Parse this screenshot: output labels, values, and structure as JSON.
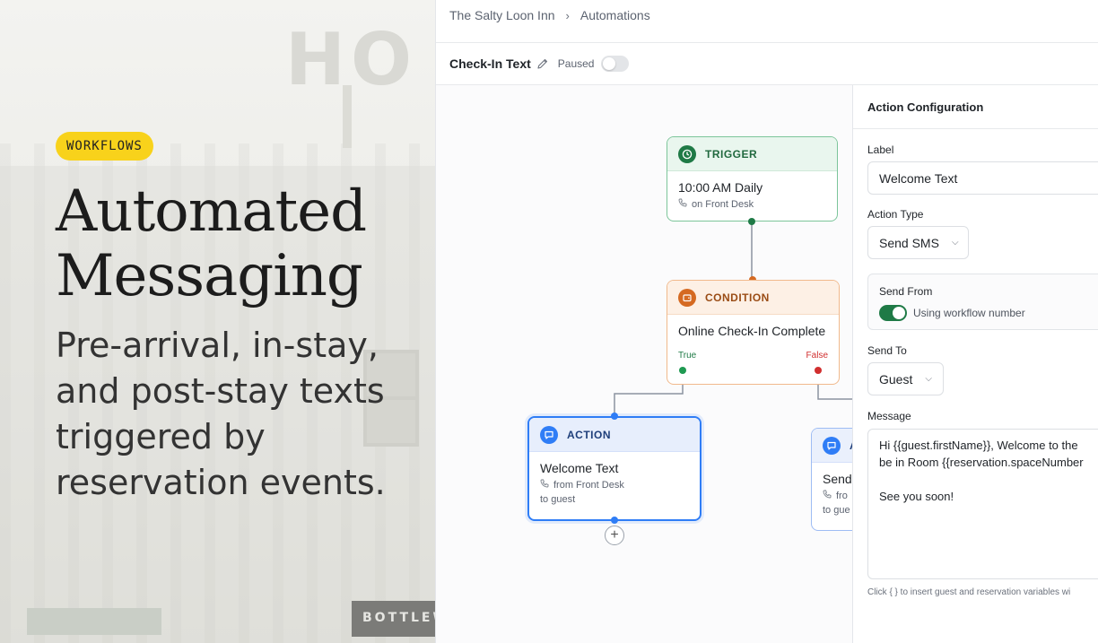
{
  "hero": {
    "badge": "WORKFLOWS",
    "title_line1": "Automated",
    "title_line2": "Messaging",
    "subtitle": "Pre-arrival, in-stay, and post-stay texts triggered by reservation events.",
    "background_sign": "HO",
    "background_store_sign": "BOTTLEW"
  },
  "breadcrumb": {
    "property": "The Salty Loon Inn",
    "section": "Automations"
  },
  "workflow": {
    "name": "Check-In Text",
    "status": "Paused"
  },
  "nodes": {
    "trigger": {
      "kind": "TRIGGER",
      "title": "10:00 AM Daily",
      "meta": "on Front Desk"
    },
    "condition": {
      "kind": "CONDITION",
      "title": "Online Check-In Complete",
      "true_label": "True",
      "false_label": "False"
    },
    "action": {
      "kind": "ACTION",
      "title": "Welcome Text",
      "meta": "from Front Desk",
      "meta2": "to guest"
    },
    "action2": {
      "kind": "A",
      "title": "Send",
      "meta": "fro",
      "meta2": "to gue"
    }
  },
  "panel": {
    "title": "Action Configuration",
    "label_label": "Label",
    "label_value": "Welcome Text",
    "action_type_label": "Action Type",
    "action_type_value": "Send SMS",
    "send_from_label": "Send From",
    "send_from_value": "Using workflow number",
    "send_to_label": "Send To",
    "send_to_value": "Guest",
    "message_label": "Message",
    "message_value": "Hi {{guest.firstName}}, Welcome to the\nbe in Room {{reservation.spaceNumber\n\nSee you soon!",
    "hint_text": "Click {  } to insert guest and reservation variables wi"
  },
  "colors": {
    "badge": "#f8d21b",
    "trigger": "#1f7a46",
    "condition": "#d56a22",
    "action": "#2f7df6",
    "true": "#1f7a46",
    "false": "#d12f2f"
  }
}
